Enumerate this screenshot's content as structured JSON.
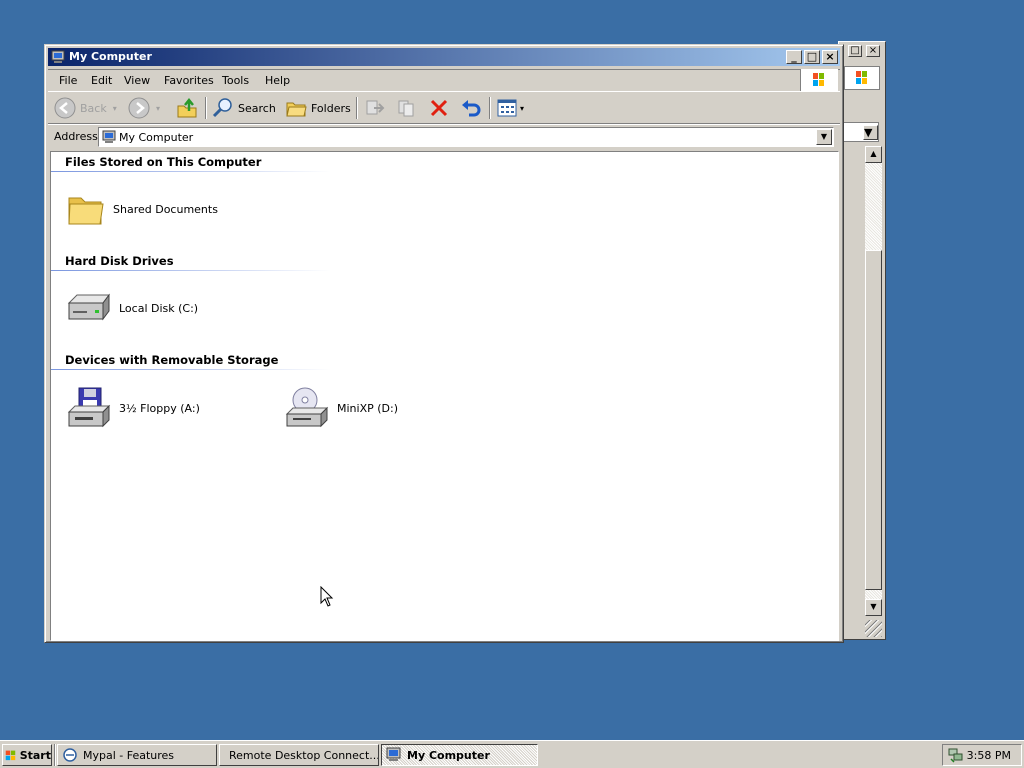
{
  "background_window": {
    "caption_buttons": [
      "□",
      "×"
    ]
  },
  "window": {
    "title": "My Computer",
    "caption_buttons": {
      "minimize": "_",
      "maximize": "□",
      "close": "×"
    },
    "menu": [
      "File",
      "Edit",
      "View",
      "Favorites",
      "Tools",
      "Help"
    ],
    "toolbar": {
      "back": "Back",
      "search": "Search",
      "folders": "Folders"
    },
    "address": {
      "label": "Address",
      "value": "My Computer"
    },
    "groups": [
      {
        "heading": "Files Stored on This Computer",
        "items": [
          {
            "label": "Shared Documents",
            "icon": "folder-icon"
          }
        ]
      },
      {
        "heading": "Hard Disk Drives",
        "items": [
          {
            "label": "Local Disk (C:)",
            "icon": "hard-disk-icon"
          }
        ]
      },
      {
        "heading": "Devices with Removable Storage",
        "items": [
          {
            "label": "3½ Floppy (A:)",
            "icon": "floppy-drive-icon"
          },
          {
            "label": "MiniXP (D:)",
            "icon": "cd-drive-icon"
          }
        ]
      }
    ]
  },
  "taskbar": {
    "start_label": "Start",
    "tasks": [
      {
        "label": "Mypal - Features",
        "active": false
      },
      {
        "label": "Remote Desktop Connect...",
        "active": false
      },
      {
        "label": "My Computer",
        "active": true
      }
    ],
    "clock": "3:58 PM"
  },
  "colors": {
    "desktop": "#3a6ea5",
    "titlebar_start": "#0a246a",
    "titlebar_end": "#a6caf0",
    "face": "#d4d0c8"
  }
}
